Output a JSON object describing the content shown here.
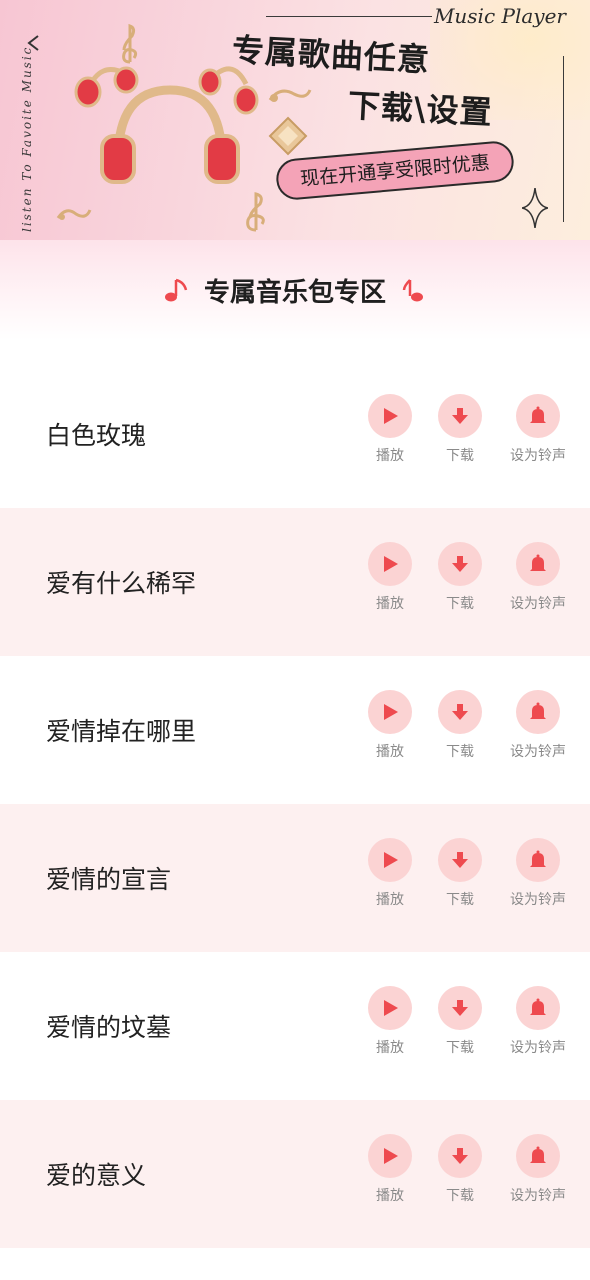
{
  "banner": {
    "brand": "Music Player",
    "vertical_text": "listen To Favoite Music",
    "headline_line1": "专属歌曲任意",
    "headline_line2": "下载\\设置",
    "promo_label": "现在开通享受限时优惠"
  },
  "section": {
    "title": "专属音乐包专区"
  },
  "actions": {
    "play_label": "播放",
    "download_label": "下载",
    "ringtone_label": "设为铃声"
  },
  "songs": [
    {
      "title": "白色玫瑰"
    },
    {
      "title": "爱有什么稀罕"
    },
    {
      "title": "爱情掉在哪里"
    },
    {
      "title": "爱情的宣言"
    },
    {
      "title": "爱情的坟墓"
    },
    {
      "title": "爱的意义"
    }
  ],
  "colors": {
    "accent": "#ee4a4f",
    "action_circle": "#fbd3d3",
    "row_alt": "#fdf0f0",
    "promo_pill": "#f4a3b7"
  }
}
